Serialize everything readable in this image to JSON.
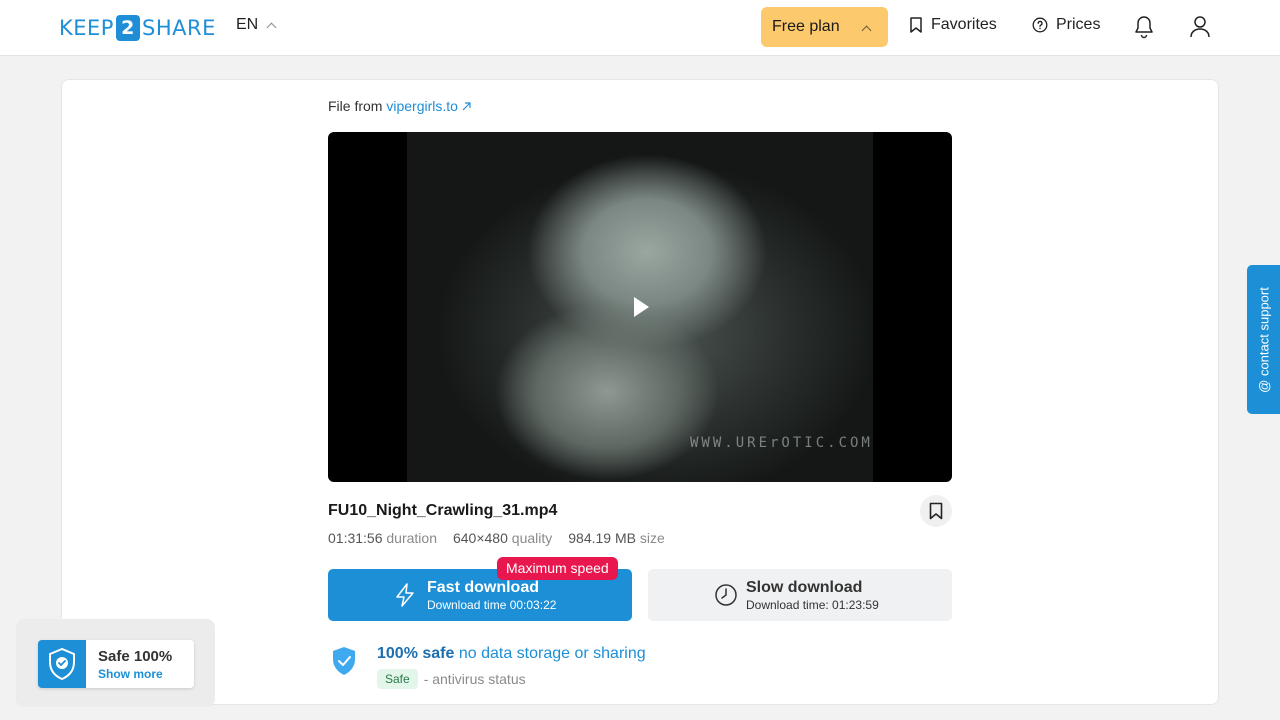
{
  "header": {
    "logo_left": "KEEP",
    "logo_mid": "2",
    "logo_right": "SHARE",
    "language": "EN",
    "plan_label": "Free plan",
    "favorites_label": "Favorites",
    "prices_label": "Prices"
  },
  "file": {
    "source_prefix": "File from",
    "source_link": "vipergirls.to",
    "name": "FU10_Night_Crawling_31.mp4",
    "duration_value": "01:31:56",
    "duration_label": "duration",
    "quality_value": "640×480",
    "quality_label": "quality",
    "size_value": "984.19 MB",
    "size_label": "size",
    "watermark": "WWW.URErOTIC.COM"
  },
  "fast_download": {
    "badge": "Maximum speed",
    "title": "Fast download",
    "subtitle": "Download time 00:03:22"
  },
  "slow_download": {
    "title": "Slow download",
    "subtitle": "Download time: 01:23:59"
  },
  "safety": {
    "strong": "100% safe",
    "text": "no data storage or sharing",
    "badge": "Safe",
    "status": "- antivirus status"
  },
  "widget": {
    "title": "Safe 100%",
    "link": "Show more"
  },
  "contact_support": "@ contact support",
  "colors": {
    "primary": "#1c8fd6",
    "plan": "#fcc96c",
    "badge": "#e8184f"
  }
}
